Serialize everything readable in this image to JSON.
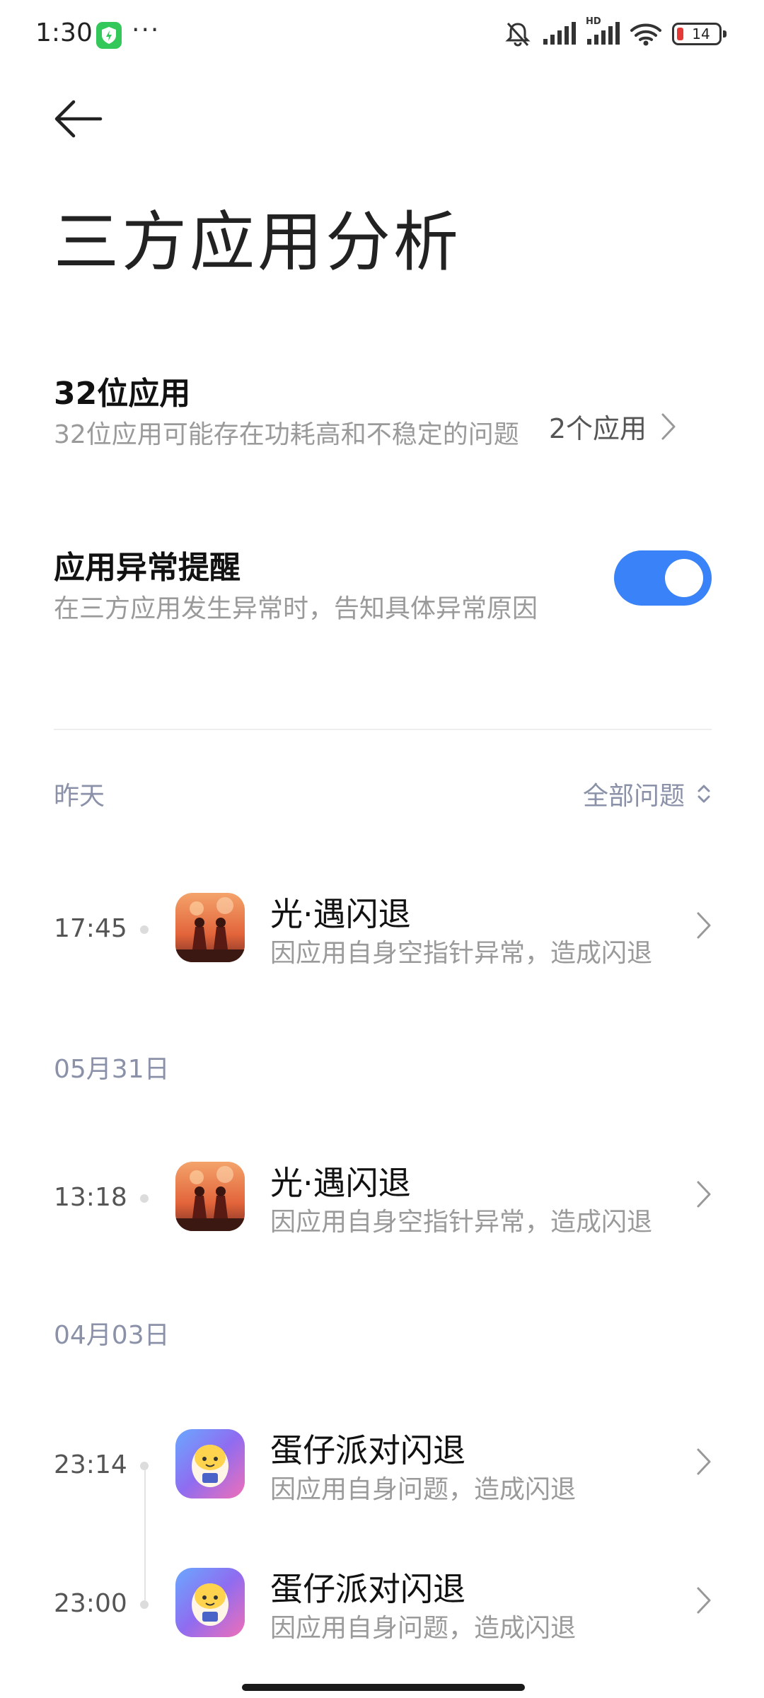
{
  "status_bar": {
    "time": "1:30",
    "dots": "···",
    "network_badge": "HD",
    "battery_level": "14"
  },
  "page": {
    "title": "三方应用分析"
  },
  "settings": {
    "apps_32bit": {
      "title": "32位应用",
      "subtitle": "32位应用可能存在功耗高和不稳定的问题",
      "value": "2个应用"
    },
    "anomaly_alert": {
      "title": "应用异常提醒",
      "subtitle": "在三方应用发生异常时，告知具体异常原因",
      "enabled": true
    }
  },
  "filter": {
    "first_group_label": "昨天",
    "label": "全部问题"
  },
  "groups": [
    {
      "date": "昨天",
      "entries": [
        {
          "time": "17:45",
          "title": "光·遇闪退",
          "subtitle": "因应用自身空指针异常，造成闪退",
          "icon": "sky-game-icon"
        }
      ]
    },
    {
      "date": "05月31日",
      "entries": [
        {
          "time": "13:18",
          "title": "光·遇闪退",
          "subtitle": "因应用自身空指针异常，造成闪退",
          "icon": "sky-game-icon"
        }
      ]
    },
    {
      "date": "04月03日",
      "entries": [
        {
          "time": "23:14",
          "title": "蛋仔派对闪退",
          "subtitle": "因应用自身问题，造成闪退",
          "icon": "eggy-party-icon"
        },
        {
          "time": "23:00",
          "title": "蛋仔派对闪退",
          "subtitle": "因应用自身问题，造成闪退",
          "icon": "eggy-party-icon"
        }
      ]
    }
  ],
  "colors": {
    "accent": "#3a82f7",
    "secondary_text": "#9a9a9a",
    "date_label": "#8a91a8"
  }
}
